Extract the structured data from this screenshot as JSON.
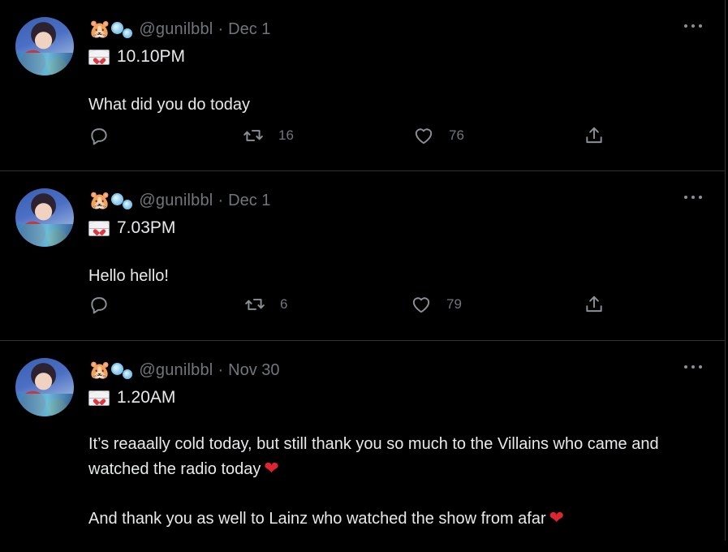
{
  "feed": {
    "tweets": [
      {
        "avatar_alt": "profile photo",
        "name_emoji": "🐹",
        "handle": "@gunilbbl",
        "separator": "·",
        "date": "Dec 1",
        "time_text": "10.10PM",
        "body": [
          "What did you do today"
        ],
        "replies": "",
        "retweets": "16",
        "likes": "76"
      },
      {
        "avatar_alt": "profile photo",
        "name_emoji": "🐹",
        "handle": "@gunilbbl",
        "separator": "·",
        "date": "Dec 1",
        "time_text": "7.03PM",
        "body": [
          "Hello hello!"
        ],
        "replies": "",
        "retweets": "6",
        "likes": "79"
      },
      {
        "avatar_alt": "profile photo",
        "name_emoji": "🐹",
        "handle": "@gunilbbl",
        "separator": "·",
        "date": "Nov 30",
        "time_text": "1.20AM",
        "body": [
          "It’s reaaally cold today, but still thank you so much to the Villains who came and watched the radio today",
          "And thank you as well to Lainz who watched the show from afar"
        ],
        "heart_emoji": "❤",
        "replies": "",
        "retweets": "",
        "likes": ""
      }
    ]
  },
  "icons": {
    "reply": "reply-icon",
    "retweet": "retweet-icon",
    "like": "like-icon",
    "share": "share-icon",
    "more": "more-icon",
    "envelope": "envelope-icon",
    "bubbles": "bubbles-icon"
  },
  "colors": {
    "background": "#000000",
    "text": "#e7e9ea",
    "muted": "#71767b",
    "divider": "#2f3336",
    "heart": "#e0242f"
  }
}
